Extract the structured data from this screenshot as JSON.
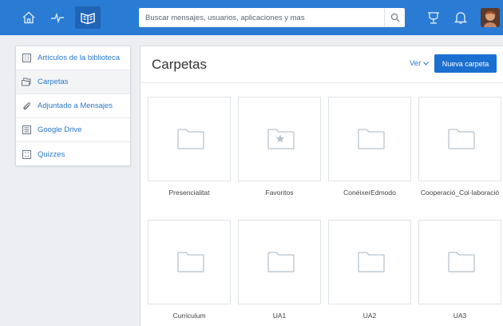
{
  "nav": {
    "icons": [
      "home-icon",
      "activity-icon",
      "library-icon",
      "cube-icon",
      "bell-icon"
    ]
  },
  "search": {
    "placeholder": "Buscar mensajes, usuarios, aplicaciones y mas"
  },
  "sidebar": {
    "items": [
      {
        "label": "Artículos de la biblioteca",
        "icon": "grid-icon"
      },
      {
        "label": "Carpetas",
        "icon": "folders-icon"
      },
      {
        "label": "Adjuntado a Mensajes",
        "icon": "paperclip-icon"
      },
      {
        "label": "Google Drive",
        "icon": "drive-icon"
      },
      {
        "label": "Quizzes",
        "icon": "quiz-icon"
      }
    ]
  },
  "main": {
    "title": "Carpetas",
    "view_label": "Ver",
    "new_folder_label": "Nueva carpeta",
    "folders": [
      {
        "label": "Presencialitat",
        "starred": false
      },
      {
        "label": "Favoritos",
        "starred": true
      },
      {
        "label": "ConéixerEdmodo",
        "starred": false
      },
      {
        "label": "Cooperació_Col·laboració",
        "starred": false
      },
      {
        "label": "Curriculum",
        "starred": false
      },
      {
        "label": "UA1",
        "starred": false
      },
      {
        "label": "UA2",
        "starred": false
      },
      {
        "label": "UA3",
        "starred": false
      }
    ]
  },
  "colors": {
    "topbar": "#2a7bd3",
    "accent": "#1a6fd0",
    "link": "#2a78cc",
    "folder_stroke": "#b8c2cc"
  }
}
